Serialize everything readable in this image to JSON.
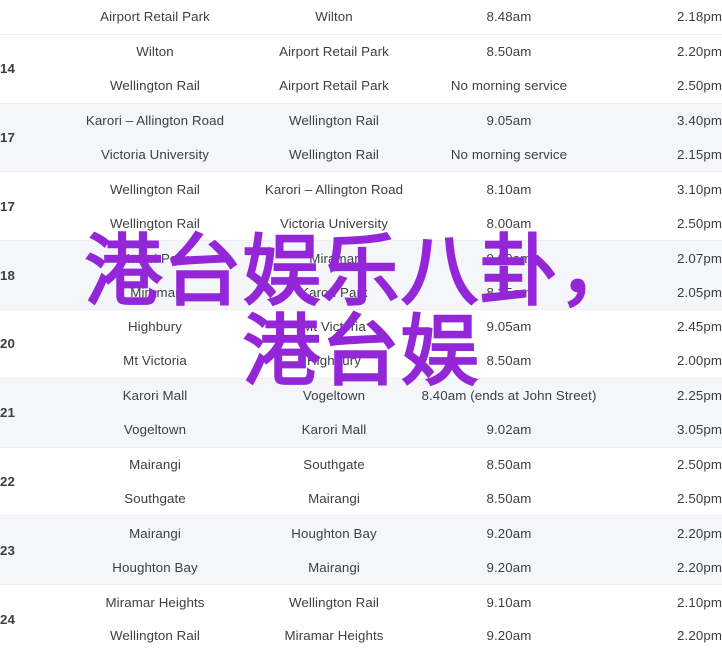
{
  "page": {
    "kind": "bus-timetable-table",
    "shaded_row_color": "#f5f6fa",
    "plain_row_color": "#ffffff",
    "text_color": "#3c4043"
  },
  "watermark": {
    "color": "#9327d8",
    "line1": "港台娱乐八卦，",
    "line2": "港台娱"
  },
  "table": {
    "groups": [
      {
        "route": "",
        "shaded": false,
        "rows": [
          {
            "from": "Airport Retail Park",
            "to": "Wilton",
            "morning": "8.48am",
            "afternoon": "2.18pm"
          }
        ]
      },
      {
        "route": "14",
        "shaded": false,
        "rows": [
          {
            "from": "Wilton",
            "to": "Airport Retail Park",
            "morning": "8.50am",
            "afternoon": "2.20pm"
          },
          {
            "from": "Wellington Rail",
            "to": "Airport Retail Park",
            "morning": "No morning service",
            "afternoon": "2.50pm"
          }
        ]
      },
      {
        "route": "17",
        "shaded": true,
        "rows": [
          {
            "from": "Karori – Allington Road",
            "to": "Wellington Rail",
            "morning": "9.05am",
            "afternoon": "3.40pm"
          },
          {
            "from": "Victoria University",
            "to": "Wellington Rail",
            "morning": "No morning service",
            "afternoon": "2.15pm"
          }
        ]
      },
      {
        "route": "17",
        "shaded": false,
        "rows": [
          {
            "from": "Wellington Rail",
            "to": "Karori – Allington Road",
            "morning": "8.10am",
            "afternoon": "3.10pm"
          },
          {
            "from": "Wellington Rail",
            "to": "Victoria University",
            "morning": "8.00am",
            "afternoon": "2.50pm"
          }
        ]
      },
      {
        "route": "18",
        "shaded": true,
        "rows": [
          {
            "from": "Karori Park",
            "to": "Miramar",
            "morning": "9.09am",
            "afternoon": "2.07pm"
          },
          {
            "from": "Miramar",
            "to": "Karori Park",
            "morning": "8.35am",
            "afternoon": "2.05pm"
          }
        ]
      },
      {
        "route": "20",
        "shaded": false,
        "rows": [
          {
            "from": "Highbury",
            "to": "Mt Victoria",
            "morning": "9.05am",
            "afternoon": "2.45pm"
          },
          {
            "from": "Mt Victoria",
            "to": "Highbury",
            "morning": "8.50am",
            "afternoon": "2.00pm"
          }
        ]
      },
      {
        "route": "21",
        "shaded": true,
        "rows": [
          {
            "from": "Karori Mall",
            "to": "Vogeltown",
            "morning": "8.40am (ends at John Street)",
            "afternoon": "2.25pm"
          },
          {
            "from": "Vogeltown",
            "to": "Karori Mall",
            "morning": "9.02am",
            "afternoon": "3.05pm"
          }
        ]
      },
      {
        "route": "22",
        "shaded": false,
        "rows": [
          {
            "from": "Mairangi",
            "to": "Southgate",
            "morning": "8.50am",
            "afternoon": "2.50pm"
          },
          {
            "from": "Southgate",
            "to": "Mairangi",
            "morning": "8.50am",
            "afternoon": "2.50pm"
          }
        ]
      },
      {
        "route": "23",
        "shaded": true,
        "rows": [
          {
            "from": "Mairangi",
            "to": "Houghton Bay",
            "morning": "9.20am",
            "afternoon": "2.20pm"
          },
          {
            "from": "Houghton Bay",
            "to": "Mairangi",
            "morning": "9.20am",
            "afternoon": "2.20pm"
          }
        ]
      },
      {
        "route": "24",
        "shaded": false,
        "rows": [
          {
            "from": "Miramar Heights",
            "to": "Wellington Rail",
            "morning": "9.10am",
            "afternoon": "2.10pm"
          },
          {
            "from": "Wellington Rail",
            "to": "Miramar Heights",
            "morning": "9.20am",
            "afternoon": "2.20pm"
          }
        ]
      }
    ]
  }
}
